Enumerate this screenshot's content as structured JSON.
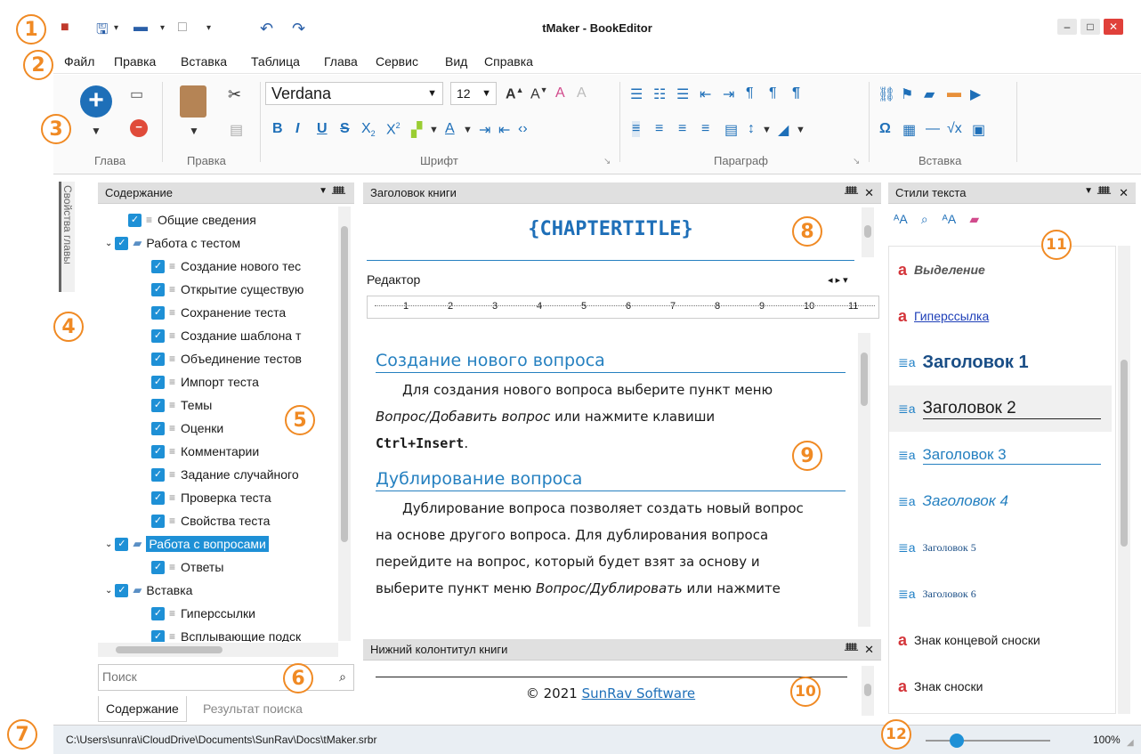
{
  "app": {
    "title": "tMaker - BookEditor"
  },
  "menu": [
    "Файл",
    "Правка",
    "Вставка",
    "Таблица",
    "Глава",
    "Сервис",
    "Вид",
    "Справка"
  ],
  "ribbon": {
    "groups": [
      "Глава",
      "Правка",
      "Шрифт",
      "Параграф",
      "Вставка"
    ],
    "font_name": "Verdana",
    "font_size": "12"
  },
  "side_tab": "Свойства главы",
  "contents": {
    "title": "Содержание",
    "items": [
      {
        "label": "Общие сведения",
        "level": 1,
        "folder": false
      },
      {
        "label": "Работа с тестом",
        "level": 0,
        "folder": true
      },
      {
        "label": "Создание нового тес",
        "level": 2,
        "folder": false
      },
      {
        "label": "Открытие существую",
        "level": 2,
        "folder": false
      },
      {
        "label": "Сохранение теста",
        "level": 2,
        "folder": false
      },
      {
        "label": "Создание шаблона т",
        "level": 2,
        "folder": false
      },
      {
        "label": "Объединение тестов",
        "level": 2,
        "folder": false
      },
      {
        "label": "Импорт теста",
        "level": 2,
        "folder": false
      },
      {
        "label": "Темы",
        "level": 2,
        "folder": false
      },
      {
        "label": "Оценки",
        "level": 2,
        "folder": false
      },
      {
        "label": "Комментарии",
        "level": 2,
        "folder": false
      },
      {
        "label": "Задание случайного",
        "level": 2,
        "folder": false
      },
      {
        "label": "Проверка теста",
        "level": 2,
        "folder": false
      },
      {
        "label": "Свойства теста",
        "level": 2,
        "folder": false
      },
      {
        "label": "Работа с вопросами",
        "level": 0,
        "folder": true,
        "selected": true
      },
      {
        "label": "Ответы",
        "level": 2,
        "folder": false
      },
      {
        "label": "Вставка",
        "level": 0,
        "folder": true
      },
      {
        "label": "Гиперссылки",
        "level": 2,
        "folder": false
      },
      {
        "label": "Всплывающие подск",
        "level": 2,
        "folder": false
      }
    ],
    "search_placeholder": "Поиск",
    "tabs": [
      "Содержание",
      "Результат поиска"
    ]
  },
  "header_panel": {
    "title": "Заголовок книги",
    "content": "{CHAPTERTITLE}"
  },
  "editor": {
    "title": "Редактор",
    "ruler": [
      "1",
      "2",
      "3",
      "4",
      "5",
      "6",
      "7",
      "8",
      "9",
      "10",
      "11"
    ],
    "h1": "Создание нового вопроса",
    "p1a": "Для создания нового вопроса выберите пункт меню",
    "p1b_italic": "Вопрос/Добавить вопрос",
    "p1b_rest": " или нажмите клавиши",
    "p1c_bold": "Ctrl+Insert",
    "p1c_rest": ".",
    "h2": "Дублирование вопроса",
    "p2a": "Дублирование вопроса позволяет создать новый вопрос",
    "p2b": "на основе другого вопроса. Для дублирования вопроса",
    "p2c": "перейдите на вопрос, который будет взят за основу и",
    "p2d": "выберите пункт меню ",
    "p2d_italic": "Вопрос/Дублировать",
    "p2d_rest": " или нажмите"
  },
  "footer_panel": {
    "title": "Нижний колонтитул книги",
    "copyright": "© 2021 ",
    "link": "SunRav Software"
  },
  "styles": {
    "title": "Стили текста",
    "items": [
      "Выделение",
      "Гиперссылка",
      "Заголовок 1",
      "Заголовок 2",
      "Заголовок 3",
      "Заголовок 4",
      "Заголовок 5",
      "Заголовок 6",
      "Знак концевой сноски",
      "Знак сноски"
    ]
  },
  "status": {
    "path": "C:\\Users\\sunra\\iCloudDrive\\Documents\\SunRav\\Docs\\tMaker.srbr",
    "zoom": "100%",
    "zoom_level": 0.25
  },
  "callouts": [
    "1",
    "2",
    "3",
    "4",
    "5",
    "6",
    "7",
    "8",
    "9",
    "10",
    "11",
    "12"
  ],
  "colors": {
    "accent": "#1e90d6",
    "callout": "#f08a24",
    "heading": "#2580c0"
  }
}
